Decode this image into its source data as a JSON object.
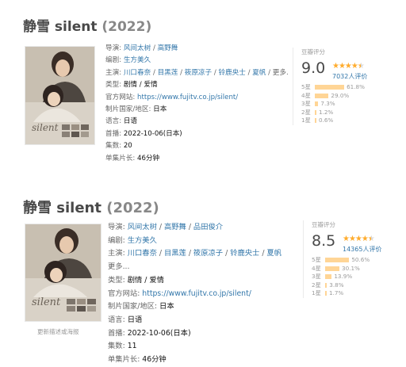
{
  "entries": [
    {
      "title": "静雪 silent",
      "year": "(2022)",
      "info": {
        "director_label": "导演:",
        "directors": [
          "风间太树",
          "高野舞"
        ],
        "writer_label": "编剧:",
        "writers": [
          "生方美久"
        ],
        "cast_label": "主演:",
        "cast": [
          "川口春奈",
          "目黑莲",
          "筱原凉子",
          "铃鹿央士",
          "夏帆"
        ],
        "cast_more": "更多...",
        "genre_label": "类型:",
        "genres": "剧情 / 爱情",
        "site_label": "官方网站:",
        "site": "https://www.fujitv.co.jp/silent/",
        "country_label": "制片国家/地区:",
        "country": "日本",
        "language_label": "语言:",
        "language": "日语",
        "premiere_label": "首播:",
        "premiere": "2022-10-06(日本)",
        "episodes_label": "集数:",
        "episodes": "20",
        "runtime_label": "单集片长:",
        "runtime": "46分钟"
      },
      "rating": {
        "label": "豆瓣评分",
        "score": "9.0",
        "stars": 4.5,
        "votes": "7032人评价",
        "distribution": [
          {
            "label": "5星",
            "percent": 61.8,
            "text": "61.8%"
          },
          {
            "label": "4星",
            "percent": 29.0,
            "text": "29.0%"
          },
          {
            "label": "3星",
            "percent": 7.3,
            "text": "7.3%"
          },
          {
            "label": "2星",
            "percent": 1.2,
            "text": "1.2%"
          },
          {
            "label": "1星",
            "percent": 0.6,
            "text": "0.6%"
          }
        ]
      }
    },
    {
      "title": "静雪 silent",
      "year": "(2022)",
      "info": {
        "director_label": "导演:",
        "directors": [
          "风间太树",
          "高野舞",
          "品田俊介"
        ],
        "writer_label": "编剧:",
        "writers": [
          "生方美久"
        ],
        "cast_label": "主演:",
        "cast": [
          "川口春奈",
          "目黑莲",
          "筱原凉子",
          "铃鹿央士",
          "夏帆"
        ],
        "cast_more": "更多...",
        "genre_label": "类型:",
        "genres": "剧情 / 爱情",
        "site_label": "官方网站:",
        "site": "https://www.fujitv.co.jp/silent/",
        "country_label": "制片国家/地区:",
        "country": "日本",
        "language_label": "语言:",
        "language": "日语",
        "premiere_label": "首播:",
        "premiere": "2022-10-06(日本)",
        "episodes_label": "集数:",
        "episodes": "11",
        "runtime_label": "单集片长:",
        "runtime": "46分钟"
      },
      "rating": {
        "label": "豆瓣评分",
        "score": "8.5",
        "stars": 4.5,
        "votes": "14365人评价",
        "distribution": [
          {
            "label": "5星",
            "percent": 50.6,
            "text": "50.6%"
          },
          {
            "label": "4星",
            "percent": 30.1,
            "text": "30.1%"
          },
          {
            "label": "3星",
            "percent": 13.9,
            "text": "13.9%"
          },
          {
            "label": "2星",
            "percent": 3.8,
            "text": "3.8%"
          },
          {
            "label": "1星",
            "percent": 1.7,
            "text": "1.7%"
          }
        ]
      },
      "poster_caption": "更新描述或海报"
    }
  ],
  "poster_text": "silent",
  "colors": {
    "link": "#3377aa",
    "bar": "#ffd596",
    "star": "#ffac2d"
  }
}
